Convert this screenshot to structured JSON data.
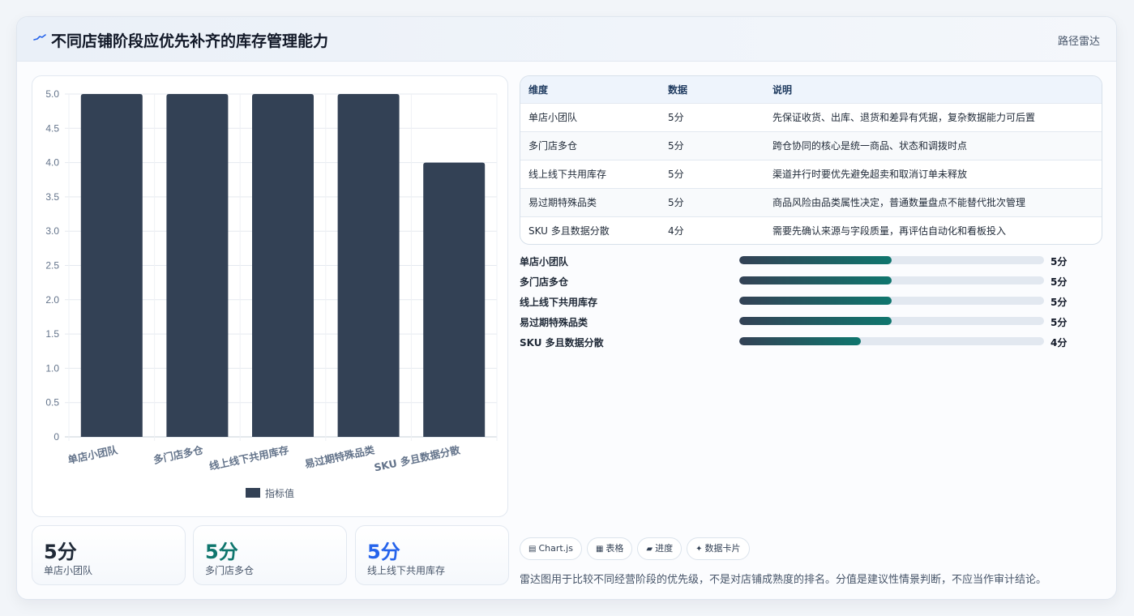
{
  "header": {
    "title": "不同店铺阶段应优先补齐的库存管理能力",
    "tag": "路径雷达",
    "icon": "pulse-icon",
    "accent": "#2563eb"
  },
  "chart_data": {
    "type": "bar",
    "categories": [
      "单店小团队",
      "多门店多仓",
      "线上线下共用库存",
      "易过期特殊品类",
      "SKU 多且数据分散"
    ],
    "series": [
      {
        "name": "指标值",
        "values": [
          5,
          5,
          5,
          5,
          4
        ],
        "color": "#334155"
      }
    ],
    "ylim": [
      0,
      5
    ],
    "yticks": [
      "0",
      "0.5",
      "1.0",
      "1.5",
      "2.0",
      "2.5",
      "3.0",
      "3.5",
      "4.0",
      "4.5",
      "5.0"
    ],
    "legend": "bottom",
    "grid": true
  },
  "stats": [
    {
      "value": "5分",
      "label": "单店小团队",
      "color": "#1f2937"
    },
    {
      "value": "5分",
      "label": "多门店多仓",
      "color": "#0f766e"
    },
    {
      "value": "5分",
      "label": "线上线下共用库存",
      "color": "#2563eb"
    }
  ],
  "table": {
    "headers": [
      "维度",
      "数据",
      "说明"
    ],
    "rows": [
      [
        "单店小团队",
        "5分",
        "先保证收货、出库、退货和差异有凭据，复杂数据能力可后置"
      ],
      [
        "多门店多仓",
        "5分",
        "跨仓协同的核心是统一商品、状态和调拨时点"
      ],
      [
        "线上线下共用库存",
        "5分",
        "渠道并行时要优先避免超卖和取消订单未释放"
      ],
      [
        "易过期特殊品类",
        "5分",
        "商品风险由品类属性决定，普通数量盘点不能替代批次管理"
      ],
      [
        "SKU 多且数据分散",
        "4分",
        "需要先确认来源与字段质量，再评估自动化和看板投入"
      ]
    ]
  },
  "progress": {
    "max": 10,
    "items": [
      {
        "label": "单店小团队",
        "value": 5,
        "text": "5分"
      },
      {
        "label": "多门店多仓",
        "value": 5,
        "text": "5分"
      },
      {
        "label": "线上线下共用库存",
        "value": 5,
        "text": "5分"
      },
      {
        "label": "易过期特殊品类",
        "value": 5,
        "text": "5分"
      },
      {
        "label": "SKU 多且数据分散",
        "value": 4,
        "text": "4分"
      }
    ]
  },
  "chips": [
    {
      "icon": "▤",
      "label": "Chart.js",
      "icon_name": "chart-icon"
    },
    {
      "icon": "▦",
      "label": "表格",
      "icon_name": "table-icon"
    },
    {
      "icon": "▰",
      "label": "进度",
      "icon_name": "progress-icon"
    },
    {
      "icon": "✦",
      "label": "数据卡片",
      "icon_name": "card-icon"
    }
  ],
  "footnote": "雷达图用于比较不同经营阶段的优先级，不是对店铺成熟度的排名。分值是建议性情景判断，不应当作审计结论。"
}
